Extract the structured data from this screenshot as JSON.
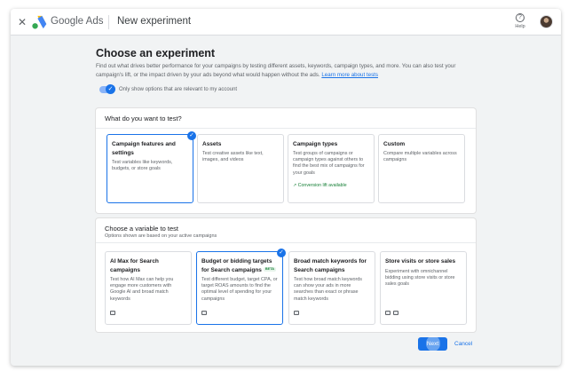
{
  "app": {
    "brand": "Google Ads",
    "page_title": "New experiment",
    "help_label": "Help"
  },
  "intro": {
    "title": "Choose an experiment",
    "description": "Find out what drives better performance for your campaigns by testing different assets, keywords, campaign types, and more. You can also test your campaign's lift, or the impact driven by your ads beyond what would happen without the ads.",
    "learn_more": "Learn more about tests",
    "toggle_label": "Only show options that are relevant to my account",
    "toggle_on": true
  },
  "test_panel": {
    "heading": "What do you want to test?",
    "cards": [
      {
        "title": "Campaign features and settings",
        "desc": "Test variables like keywords, budgets, or store goals",
        "selected": true
      },
      {
        "title": "Assets",
        "desc": "Test creative assets like text, images, and videos",
        "selected": false
      },
      {
        "title": "Campaign types",
        "desc": "Test groups of campaigns or campaign types against others to find the best mix of campaigns for your goals",
        "extra": "Conversion lift available",
        "selected": false
      },
      {
        "title": "Custom",
        "desc": "Compare multiple variables across campaigns",
        "selected": false
      }
    ]
  },
  "variable_panel": {
    "heading": "Choose a variable to test",
    "subheading": "Options shown are based on your active campaigns",
    "cards": [
      {
        "title": "AI Max for Search campaigns",
        "desc": "Test how AI Max can help you engage more customers with Google AI and broad match keywords",
        "selected": false
      },
      {
        "title": "Budget or bidding targets for Search campaigns",
        "badge": "BETA",
        "desc": "Test different budget, target CPA, or target ROAS amounts to find the optimal level of spending for your campaigns",
        "selected": true
      },
      {
        "title": "Broad match keywords for Search campaigns",
        "desc": "Test how broad match keywords can show your ads in more searches than exact or phrase match keywords",
        "selected": false
      },
      {
        "title": "Store visits or store sales",
        "desc": "Experiment with omnichannel bidding using store visits or store sales goals",
        "selected": false
      }
    ]
  },
  "footer": {
    "next_label": "Next",
    "cancel_label": "Cancel"
  },
  "colors": {
    "accent": "#1a73e8",
    "success": "#188038",
    "canvas": "#f1f3f4"
  },
  "icons": [
    "close-icon",
    "google-ads-logo",
    "help-icon",
    "avatar",
    "checkmark-icon",
    "trending-up-icon",
    "search-icon",
    "shopping-icon"
  ]
}
